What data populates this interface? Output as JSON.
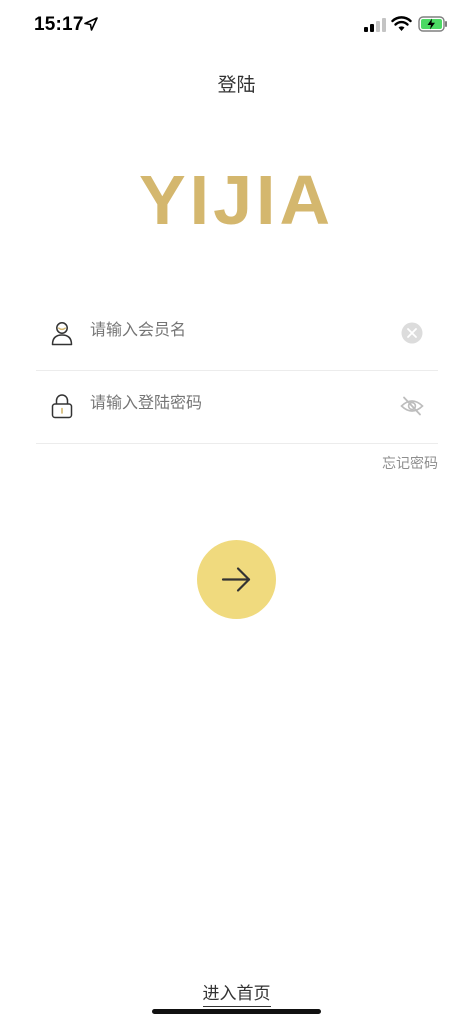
{
  "status_bar": {
    "time": "15:17",
    "icons": [
      "location-arrow-icon",
      "signal-icon",
      "wifi-icon",
      "battery-charging-icon"
    ]
  },
  "header": {
    "title": "登陆"
  },
  "logo": {
    "text": "YIJIA",
    "color": "#d4b76e"
  },
  "form": {
    "username": {
      "placeholder": "请输入会员名",
      "value": "",
      "left_icon": "user-icon",
      "right_icon": "clear-icon"
    },
    "password": {
      "placeholder": "请输入登陆密码",
      "value": "",
      "left_icon": "lock-icon",
      "right_icon": "eye-off-icon"
    },
    "forgot_label": "忘记密码"
  },
  "submit": {
    "icon": "arrow-right-icon",
    "color": "#f0da7e"
  },
  "footer": {
    "enter_home_label": "进入首页"
  }
}
